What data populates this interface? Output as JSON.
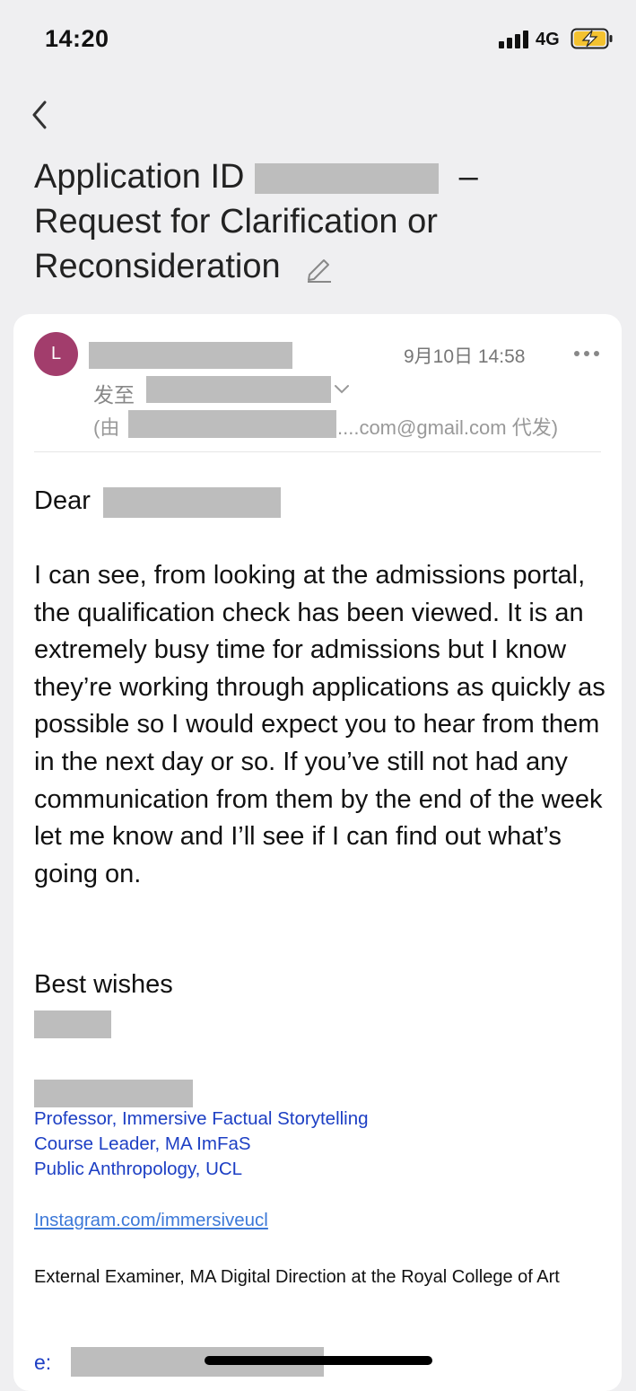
{
  "status_bar": {
    "time": "14:20",
    "network": "4G",
    "battery_charging": true
  },
  "subject": {
    "prefix": "Application ID",
    "dash": "–",
    "rest": "Request for Clarification or Reconsideration"
  },
  "message": {
    "avatar_initial": "L",
    "date": "9月10日 14:58",
    "to_label": "发至",
    "via_open": "(由",
    "via_rest": "....com@gmail.com 代发)"
  },
  "body": {
    "greeting": "Dear",
    "paragraph": "I can see, from looking at the admissions portal, the qualification check has been viewed.  It is an extremely busy time for admissions but I know they’re working through applications as quickly as possible so I would expect you to hear from them in the next day or so.  If you’ve still not had any communication from them by the end of the week let me know and I’ll see if I can find out what’s going on.",
    "closing": "Best wishes"
  },
  "signature": {
    "title_line1": "Professor, Immersive Factual Storytelling",
    "title_line2": "Course Leader, MA ImFaS",
    "title_line3": "Public Anthropology, UCL",
    "instagram": "Instagram.com/immersiveucl",
    "examiner": "External Examiner, MA Digital Direction at the Royal College of Art",
    "email_label": "e:"
  },
  "colors": {
    "avatar": "#a23d6c",
    "signature_blue": "#1d3fc4",
    "link_blue": "#3c78d8",
    "redaction": "#bdbdbd"
  }
}
